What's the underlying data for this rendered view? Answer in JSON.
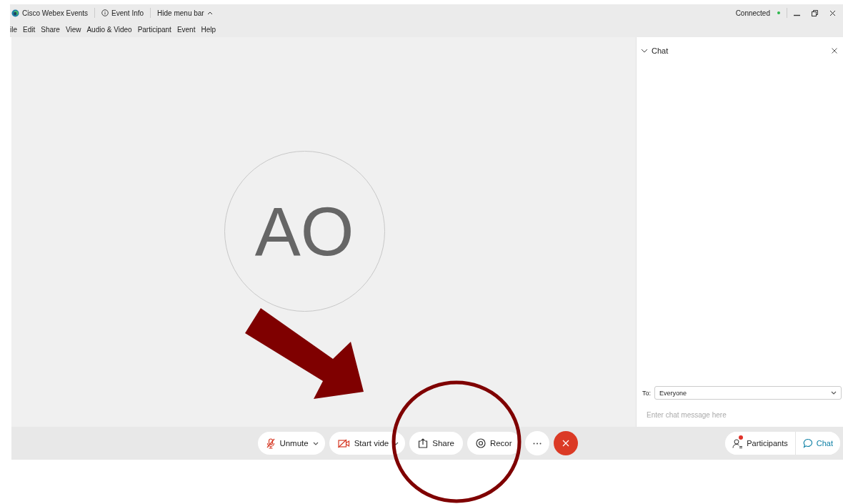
{
  "title_bar": {
    "app_name": "Cisco Webex Events",
    "event_info": "Event Info",
    "hide_menu": "Hide menu bar",
    "status": "Connected"
  },
  "menu_bar": [
    "ile",
    "Edit",
    "Share",
    "View",
    "Audio & Video",
    "Participant",
    "Event",
    "Help"
  ],
  "stage": {
    "avatar_initials": "AO"
  },
  "chat_panel": {
    "title": "Chat",
    "expanded": true,
    "to_label": "To:",
    "recipient": "Everyone",
    "placeholder": "Enter chat message here"
  },
  "controls": [
    {
      "kind": "mute",
      "label": "Unmute",
      "dropdown": true
    },
    {
      "kind": "video",
      "label": "Start vide",
      "dropdown": true
    },
    {
      "kind": "share",
      "label": "Share"
    },
    {
      "kind": "record",
      "label": "Recor"
    },
    {
      "kind": "more"
    },
    {
      "kind": "end"
    }
  ],
  "panel_buttons": [
    {
      "kind": "participants",
      "label": "Participants",
      "alert": true,
      "selected": false
    },
    {
      "kind": "chat",
      "label": "Chat",
      "selected": true
    }
  ]
}
